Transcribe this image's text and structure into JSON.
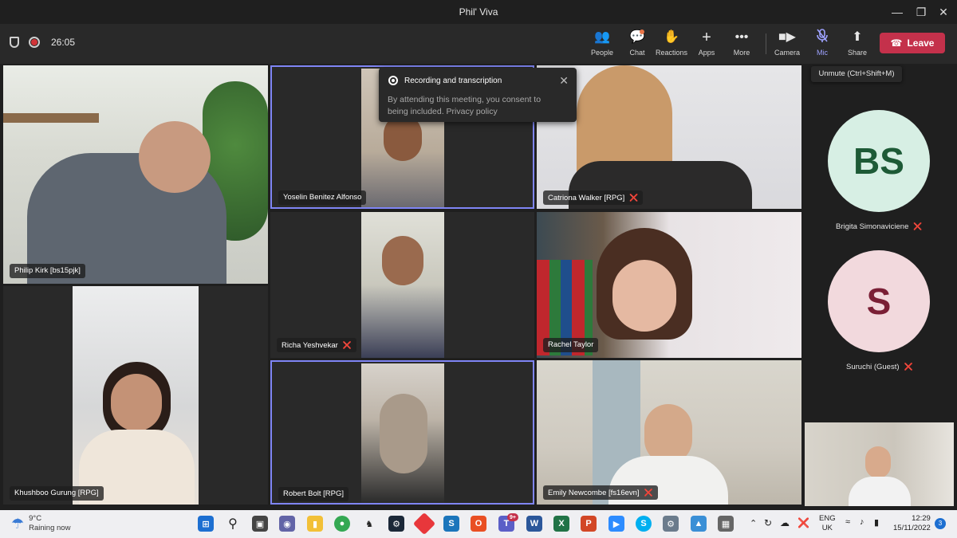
{
  "window": {
    "title": "Phil' Viva"
  },
  "meeting": {
    "timer": "26:05"
  },
  "toolbar": {
    "people": "People",
    "chat": "Chat",
    "reactions": "Reactions",
    "apps": "Apps",
    "more": "More",
    "camera": "Camera",
    "mic": "Mic",
    "share": "Share",
    "leave": "Leave",
    "mic_tooltip": "Unmute (Ctrl+Shift+M)"
  },
  "notification": {
    "title": "Recording and transcription",
    "body": "By attending this meeting, you consent to being included. Privacy policy"
  },
  "participants": {
    "philip": "Philip Kirk [bs15pjk]",
    "yoselin": "Yoselin Benitez Alfonso",
    "catriona": "Catriona Walker [RPG]",
    "richa": "Richa Yeshvekar",
    "rachel": "Rachel Taylor",
    "khushboo": "Khushboo Gurung [RPG]",
    "robert": "Robert Bolt [RPG]",
    "emily": "Emily Newcombe [fs16evn]",
    "brigita": "Brigita Simonaviciene",
    "suruchi": "Suruchi (Guest)"
  },
  "avatars": {
    "brigita_initials": "BS",
    "suruchi_initials": "S"
  },
  "taskbar": {
    "temperature": "9°C",
    "weather": "Raining now",
    "lang1": "ENG",
    "lang2": "UK",
    "time": "12:29",
    "date": "15/11/2022",
    "notif_count": "3",
    "teams_badge": "9+"
  },
  "colors": {
    "accent": "#7f85f5",
    "leave": "#c4314b",
    "avatar_bs_bg": "#d7efe4",
    "avatar_bs_fg": "#1d5a36",
    "avatar_s_bg": "#f2d9dd",
    "avatar_s_fg": "#7a1f35"
  }
}
